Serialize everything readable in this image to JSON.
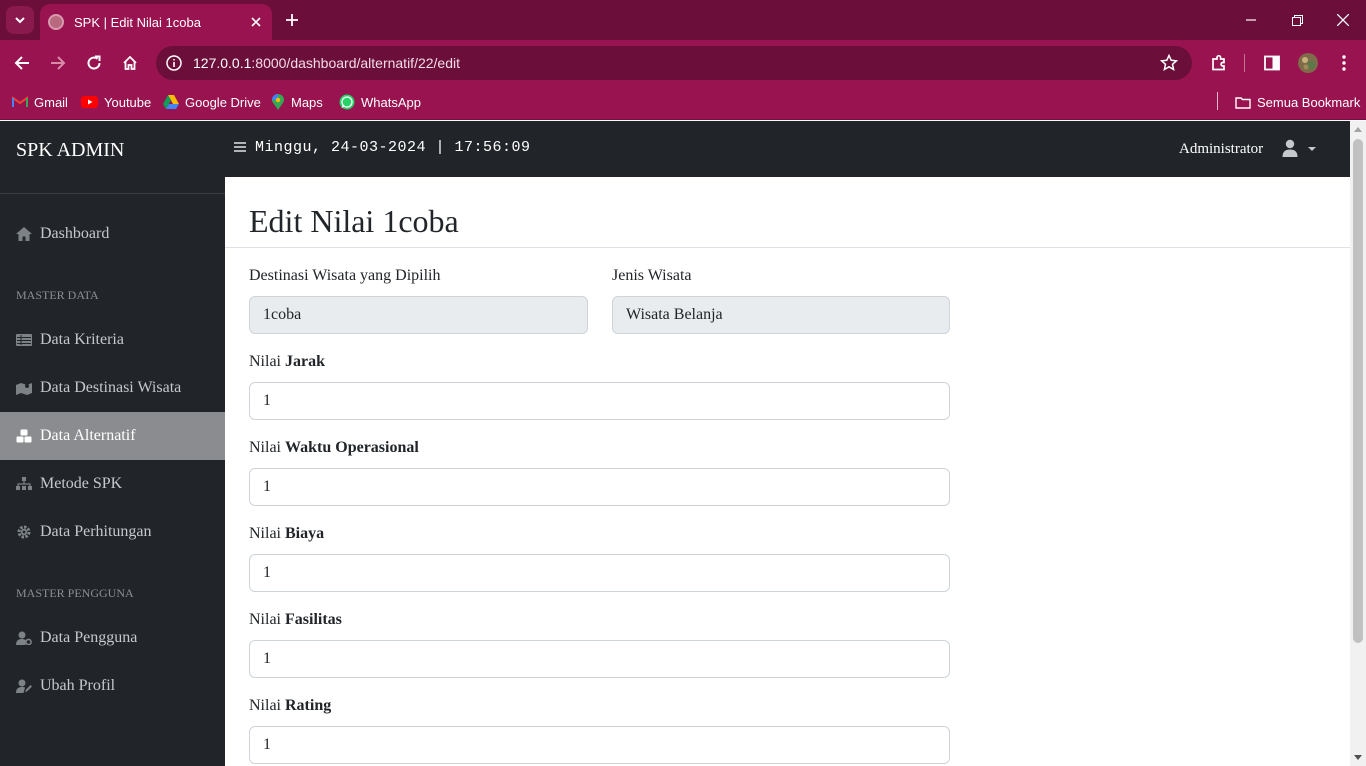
{
  "browser": {
    "tab_title": "SPK | Edit Nilai 1coba",
    "url_host": "127.0.0.1",
    "url_rest": ":8000/dashboard/alternatif/22/edit",
    "bookmarks": [
      "Gmail",
      "Youtube",
      "Google Drive",
      "Maps",
      "WhatsApp"
    ],
    "all_bookmarks": "Semua Bookmark"
  },
  "sidebar": {
    "brand": "SPK ADMIN",
    "dashboard": "Dashboard",
    "section_master_data": "MASTER DATA",
    "items": [
      "Data Kriteria",
      "Data Destinasi Wisata",
      "Data Alternatif",
      "Metode SPK",
      "Data Perhitungan"
    ],
    "section_master_pengguna": "MASTER PENGGUNA",
    "user_items": [
      "Data Pengguna",
      "Ubah Profil"
    ],
    "active_item": "Data Alternatif"
  },
  "topnav": {
    "datetime": "Minggu, 24-03-2024 | 17:56:09",
    "user": "Administrator"
  },
  "page": {
    "title": "Edit Nilai 1coba",
    "destinasi_label": "Destinasi Wisata yang Dipilih",
    "destinasi_value": "1coba",
    "jenis_label": "Jenis Wisata",
    "jenis_value": "Wisata Belanja",
    "nilai_prefix": "Nilai",
    "fields": [
      {
        "name": "Jarak",
        "value": "1"
      },
      {
        "name": "Waktu Operasional",
        "value": "1"
      },
      {
        "name": "Biaya",
        "value": "1"
      },
      {
        "name": "Fasilitas",
        "value": "1"
      },
      {
        "name": "Rating",
        "value": "1"
      }
    ]
  },
  "colors": {
    "chrome_dark": "#6b0f3a",
    "chrome": "#98134f",
    "sidebar": "#212529",
    "active_item": "#8a8c8f"
  }
}
